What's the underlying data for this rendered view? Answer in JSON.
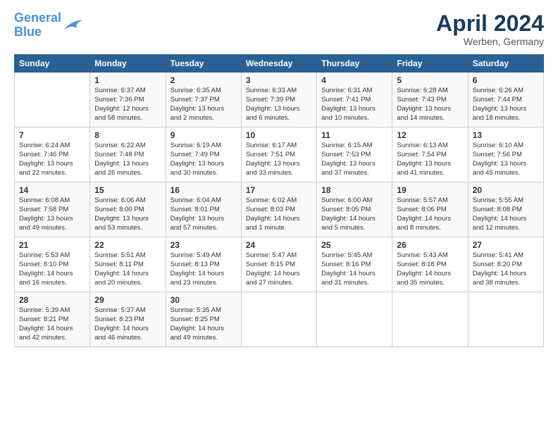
{
  "header": {
    "logo_line1": "General",
    "logo_line2": "Blue",
    "month": "April 2024",
    "location": "Werben, Germany"
  },
  "days_of_week": [
    "Sunday",
    "Monday",
    "Tuesday",
    "Wednesday",
    "Thursday",
    "Friday",
    "Saturday"
  ],
  "weeks": [
    [
      {
        "day": "",
        "sunrise": "",
        "sunset": "",
        "daylight": ""
      },
      {
        "day": "1",
        "sunrise": "Sunrise: 6:37 AM",
        "sunset": "Sunset: 7:36 PM",
        "daylight": "Daylight: 12 hours and 58 minutes."
      },
      {
        "day": "2",
        "sunrise": "Sunrise: 6:35 AM",
        "sunset": "Sunset: 7:37 PM",
        "daylight": "Daylight: 13 hours and 2 minutes."
      },
      {
        "day": "3",
        "sunrise": "Sunrise: 6:33 AM",
        "sunset": "Sunset: 7:39 PM",
        "daylight": "Daylight: 13 hours and 6 minutes."
      },
      {
        "day": "4",
        "sunrise": "Sunrise: 6:31 AM",
        "sunset": "Sunset: 7:41 PM",
        "daylight": "Daylight: 13 hours and 10 minutes."
      },
      {
        "day": "5",
        "sunrise": "Sunrise: 6:28 AM",
        "sunset": "Sunset: 7:43 PM",
        "daylight": "Daylight: 13 hours and 14 minutes."
      },
      {
        "day": "6",
        "sunrise": "Sunrise: 6:26 AM",
        "sunset": "Sunset: 7:44 PM",
        "daylight": "Daylight: 13 hours and 18 minutes."
      }
    ],
    [
      {
        "day": "7",
        "sunrise": "Sunrise: 6:24 AM",
        "sunset": "Sunset: 7:46 PM",
        "daylight": "Daylight: 13 hours and 22 minutes."
      },
      {
        "day": "8",
        "sunrise": "Sunrise: 6:22 AM",
        "sunset": "Sunset: 7:48 PM",
        "daylight": "Daylight: 13 hours and 26 minutes."
      },
      {
        "day": "9",
        "sunrise": "Sunrise: 6:19 AM",
        "sunset": "Sunset: 7:49 PM",
        "daylight": "Daylight: 13 hours and 30 minutes."
      },
      {
        "day": "10",
        "sunrise": "Sunrise: 6:17 AM",
        "sunset": "Sunset: 7:51 PM",
        "daylight": "Daylight: 13 hours and 33 minutes."
      },
      {
        "day": "11",
        "sunrise": "Sunrise: 6:15 AM",
        "sunset": "Sunset: 7:53 PM",
        "daylight": "Daylight: 13 hours and 37 minutes."
      },
      {
        "day": "12",
        "sunrise": "Sunrise: 6:13 AM",
        "sunset": "Sunset: 7:54 PM",
        "daylight": "Daylight: 13 hours and 41 minutes."
      },
      {
        "day": "13",
        "sunrise": "Sunrise: 6:10 AM",
        "sunset": "Sunset: 7:56 PM",
        "daylight": "Daylight: 13 hours and 45 minutes."
      }
    ],
    [
      {
        "day": "14",
        "sunrise": "Sunrise: 6:08 AM",
        "sunset": "Sunset: 7:58 PM",
        "daylight": "Daylight: 13 hours and 49 minutes."
      },
      {
        "day": "15",
        "sunrise": "Sunrise: 6:06 AM",
        "sunset": "Sunset: 8:00 PM",
        "daylight": "Daylight: 13 hours and 53 minutes."
      },
      {
        "day": "16",
        "sunrise": "Sunrise: 6:04 AM",
        "sunset": "Sunset: 8:01 PM",
        "daylight": "Daylight: 13 hours and 57 minutes."
      },
      {
        "day": "17",
        "sunrise": "Sunrise: 6:02 AM",
        "sunset": "Sunset: 8:03 PM",
        "daylight": "Daylight: 14 hours and 1 minute."
      },
      {
        "day": "18",
        "sunrise": "Sunrise: 6:00 AM",
        "sunset": "Sunset: 8:05 PM",
        "daylight": "Daylight: 14 hours and 5 minutes."
      },
      {
        "day": "19",
        "sunrise": "Sunrise: 5:57 AM",
        "sunset": "Sunset: 8:06 PM",
        "daylight": "Daylight: 14 hours and 8 minutes."
      },
      {
        "day": "20",
        "sunrise": "Sunrise: 5:55 AM",
        "sunset": "Sunset: 8:08 PM",
        "daylight": "Daylight: 14 hours and 12 minutes."
      }
    ],
    [
      {
        "day": "21",
        "sunrise": "Sunrise: 5:53 AM",
        "sunset": "Sunset: 8:10 PM",
        "daylight": "Daylight: 14 hours and 16 minutes."
      },
      {
        "day": "22",
        "sunrise": "Sunrise: 5:51 AM",
        "sunset": "Sunset: 8:11 PM",
        "daylight": "Daylight: 14 hours and 20 minutes."
      },
      {
        "day": "23",
        "sunrise": "Sunrise: 5:49 AM",
        "sunset": "Sunset: 8:13 PM",
        "daylight": "Daylight: 14 hours and 23 minutes."
      },
      {
        "day": "24",
        "sunrise": "Sunrise: 5:47 AM",
        "sunset": "Sunset: 8:15 PM",
        "daylight": "Daylight: 14 hours and 27 minutes."
      },
      {
        "day": "25",
        "sunrise": "Sunrise: 5:45 AM",
        "sunset": "Sunset: 8:16 PM",
        "daylight": "Daylight: 14 hours and 31 minutes."
      },
      {
        "day": "26",
        "sunrise": "Sunrise: 5:43 AM",
        "sunset": "Sunset: 8:18 PM",
        "daylight": "Daylight: 14 hours and 35 minutes."
      },
      {
        "day": "27",
        "sunrise": "Sunrise: 5:41 AM",
        "sunset": "Sunset: 8:20 PM",
        "daylight": "Daylight: 14 hours and 38 minutes."
      }
    ],
    [
      {
        "day": "28",
        "sunrise": "Sunrise: 5:39 AM",
        "sunset": "Sunset: 8:21 PM",
        "daylight": "Daylight: 14 hours and 42 minutes."
      },
      {
        "day": "29",
        "sunrise": "Sunrise: 5:37 AM",
        "sunset": "Sunset: 8:23 PM",
        "daylight": "Daylight: 14 hours and 46 minutes."
      },
      {
        "day": "30",
        "sunrise": "Sunrise: 5:35 AM",
        "sunset": "Sunset: 8:25 PM",
        "daylight": "Daylight: 14 hours and 49 minutes."
      },
      {
        "day": "",
        "sunrise": "",
        "sunset": "",
        "daylight": ""
      },
      {
        "day": "",
        "sunrise": "",
        "sunset": "",
        "daylight": ""
      },
      {
        "day": "",
        "sunrise": "",
        "sunset": "",
        "daylight": ""
      },
      {
        "day": "",
        "sunrise": "",
        "sunset": "",
        "daylight": ""
      }
    ]
  ]
}
